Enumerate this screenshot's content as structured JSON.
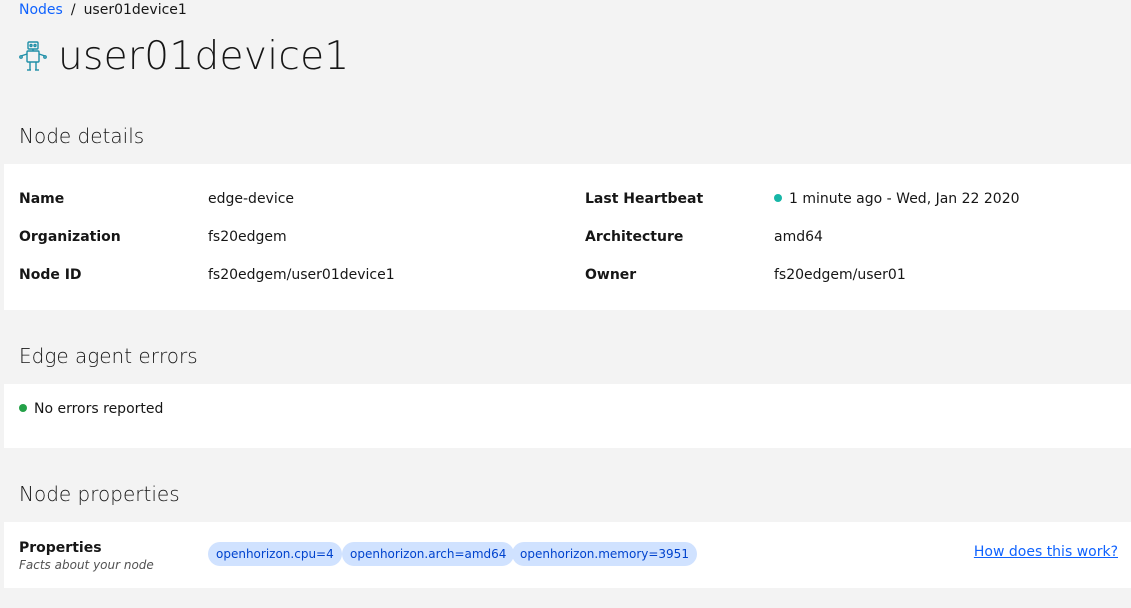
{
  "breadcrumb": {
    "parent": "Nodes",
    "separator": "/",
    "current": "user01device1"
  },
  "page": {
    "title": "user01device1",
    "icon": "robot-icon"
  },
  "sections": {
    "details_title": "Node details",
    "errors_title": "Edge agent errors",
    "properties_title": "Node properties"
  },
  "details": {
    "name_label": "Name",
    "name_value": "edge-device",
    "org_label": "Organization",
    "org_value": "fs20edgem",
    "nodeid_label": "Node ID",
    "nodeid_value": "fs20edgem/user01device1",
    "heartbeat_label": "Last Heartbeat",
    "heartbeat_value": "1 minute ago - Wed, Jan 22 2020",
    "arch_label": "Architecture",
    "arch_value": "amd64",
    "owner_label": "Owner",
    "owner_value": "fs20edgem/user01"
  },
  "errors": {
    "status_text": "No errors reported"
  },
  "properties": {
    "label": "Properties",
    "subtitle": "Facts about your node",
    "tags": [
      "openhorizon.cpu=4",
      "openhorizon.arch=amd64",
      "openhorizon.memory=3951"
    ],
    "help_link": "How does this work?"
  },
  "colors": {
    "heartbeat_dot": "#17b6a7",
    "ok_dot": "#24a148",
    "link": "#0f62fe",
    "tag_bg": "#d0e2ff",
    "tag_text": "#0043ce"
  }
}
